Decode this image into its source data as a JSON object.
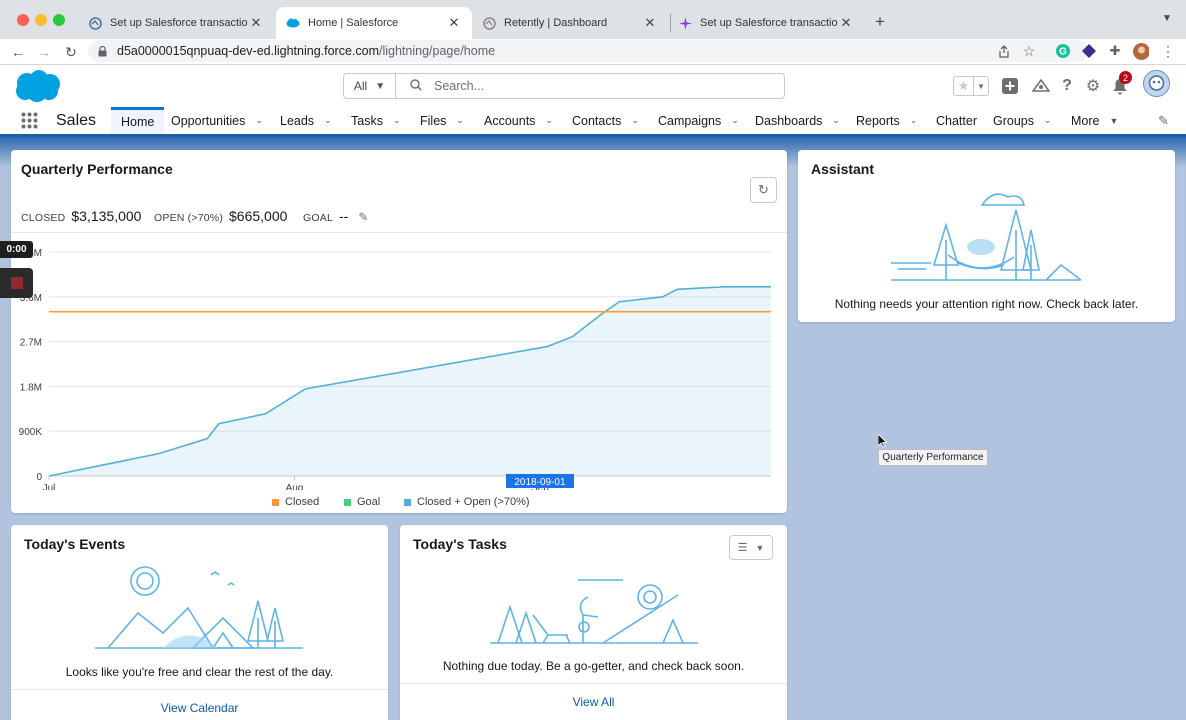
{
  "browser": {
    "tabs": [
      {
        "title": "Set up Salesforce transactional",
        "active": false
      },
      {
        "title": "Home | Salesforce",
        "active": true
      },
      {
        "title": "Retently | Dashboard",
        "active": false
      },
      {
        "title": "Set up Salesforce transactional",
        "active": false
      }
    ],
    "url_host": "d5a0000015qnpuaq-dev-ed.lightning.force.com",
    "url_path": "/lightning/page/home"
  },
  "header": {
    "search_scope": "All",
    "search_placeholder": "Search...",
    "notification_count": "2"
  },
  "nav": {
    "app_name": "Sales",
    "items": [
      {
        "label": "Home",
        "active": true,
        "menu": false
      },
      {
        "label": "Opportunities",
        "menu": true
      },
      {
        "label": "Leads",
        "menu": true
      },
      {
        "label": "Tasks",
        "menu": true
      },
      {
        "label": "Files",
        "menu": true
      },
      {
        "label": "Accounts",
        "menu": true
      },
      {
        "label": "Contacts",
        "menu": true
      },
      {
        "label": "Campaigns",
        "menu": true
      },
      {
        "label": "Dashboards",
        "menu": true
      },
      {
        "label": "Reports",
        "menu": true
      },
      {
        "label": "Chatter",
        "menu": false
      },
      {
        "label": "Groups",
        "menu": true
      },
      {
        "label": "More",
        "menu": true
      }
    ]
  },
  "performance": {
    "title": "Quarterly Performance",
    "closed_label": "CLOSED",
    "closed_value": "$3,135,000",
    "open_label": "OPEN (>70%)",
    "open_value": "$665,000",
    "goal_label": "GOAL",
    "goal_value": "--"
  },
  "recording": {
    "timer": "0:00"
  },
  "chart_data": {
    "type": "line",
    "title": "",
    "x_ticks": [
      "Jul",
      "Aug",
      "Sep"
    ],
    "y_ticks": [
      "0",
      "900K",
      "1.8M",
      "2.7M",
      "3.6M",
      "4.5M"
    ],
    "ylim": [
      0,
      4500000
    ],
    "hover_label": "2018-09-01",
    "grid": true,
    "legend_position": "bottom",
    "series": [
      {
        "name": "Closed",
        "color": "#ff9a3c",
        "values": []
      },
      {
        "name": "Goal",
        "color": "#4bca81",
        "values": []
      },
      {
        "name": "Closed + Open (>70%)",
        "color": "#54b0d6",
        "area": true,
        "points": [
          [
            0,
            0
          ],
          [
            0.152,
            450000
          ],
          [
            0.219,
            750000
          ],
          [
            0.235,
            1050000
          ],
          [
            0.3,
            1250000
          ],
          [
            0.355,
            1750000
          ],
          [
            0.69,
            2600000
          ],
          [
            0.725,
            2800000
          ],
          [
            0.765,
            3250000
          ],
          [
            0.79,
            3500000
          ],
          [
            0.85,
            3600000
          ],
          [
            0.87,
            3750000
          ],
          [
            0.935,
            3800000
          ],
          [
            0.93,
            3800000
          ],
          [
            1.0,
            3800000
          ]
        ]
      },
      {
        "name": "Goal line",
        "color": "#ff9a3c",
        "points": [
          [
            0,
            3300000
          ],
          [
            1,
            3300000
          ]
        ]
      }
    ]
  },
  "tooltip": {
    "text": "Quarterly Performance"
  },
  "assistant": {
    "title": "Assistant",
    "message": "Nothing needs your attention right now. Check back later."
  },
  "events": {
    "title": "Today's Events",
    "message": "Looks like you're free and clear the rest of the day.",
    "link": "View Calendar"
  },
  "tasks": {
    "title": "Today's Tasks",
    "message": "Nothing due today. Be a go-getter, and check back soon.",
    "link": "View All"
  }
}
